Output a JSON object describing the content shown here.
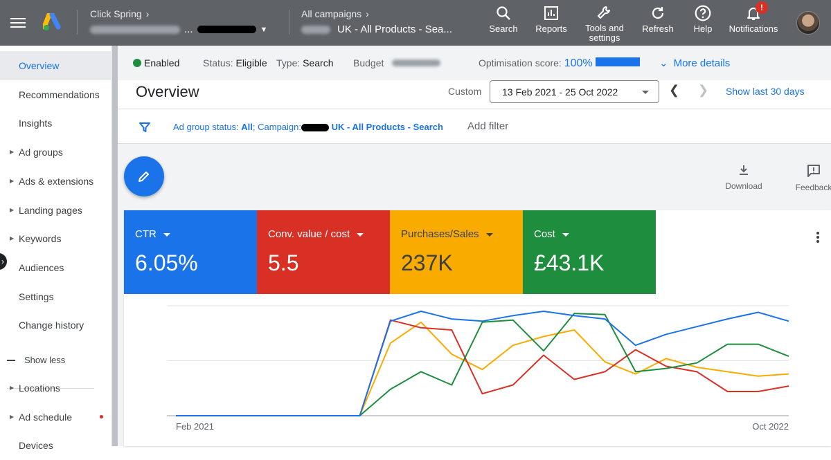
{
  "topbar": {
    "account_label": "Click Spring",
    "account_suffix": "...",
    "campaign_label": "All campaigns",
    "campaign_name": "UK - All Products - Sea...",
    "actions": [
      {
        "label": "Search",
        "icon": "search-icon"
      },
      {
        "label": "Reports",
        "icon": "reports-icon"
      },
      {
        "label": "Tools and\nsettings",
        "icon": "wrench-icon"
      },
      {
        "label": "Refresh",
        "icon": "refresh-icon"
      },
      {
        "label": "Help",
        "icon": "help-icon"
      },
      {
        "label": "Notifications",
        "icon": "bell-icon",
        "badge": "!"
      }
    ]
  },
  "sidebar": {
    "items": [
      {
        "label": "Overview",
        "active": true
      },
      {
        "label": "Recommendations"
      },
      {
        "label": "Insights"
      },
      {
        "label": "Ad groups",
        "expandable": true
      },
      {
        "label": "Ads & extensions",
        "expandable": true
      },
      {
        "label": "Landing pages",
        "expandable": true
      },
      {
        "label": "Keywords",
        "expandable": true
      },
      {
        "label": "Audiences"
      },
      {
        "label": "Settings"
      },
      {
        "label": "Change history"
      }
    ],
    "show_less": "Show less",
    "more_items": [
      {
        "label": "Locations",
        "expandable": true
      },
      {
        "label": "Ad schedule",
        "expandable": true,
        "alert": true
      },
      {
        "label": "Devices"
      }
    ]
  },
  "status": {
    "enabled": "Enabled",
    "status_label": "Status:",
    "status_value": "Eligible",
    "type_label": "Type:",
    "type_value": "Search",
    "budget_label": "Budget",
    "opt_label": "Optimisation score:",
    "opt_value": "100%",
    "opt_fraction": 1.0,
    "more_details": "More details"
  },
  "header": {
    "title": "Overview",
    "range_label": "Custom",
    "date_range": "13 Feb 2021 - 25 Oct 2022",
    "show_last": "Show last 30 days"
  },
  "filter": {
    "prefix": "Ad group status: ",
    "status": "All",
    "campaign_prefix": "; Campaign:",
    "campaign": " UK - All Products - Search",
    "add_filter": "Add filter"
  },
  "actions": {
    "download": "Download",
    "feedback": "Feedback"
  },
  "metrics": [
    {
      "label": "CTR",
      "value": "6.05%",
      "color": "#1a73e8"
    },
    {
      "label": "Conv. value / cost",
      "value": "5.5",
      "color": "#d93025"
    },
    {
      "label": "Purchases/Sales",
      "value": "237K",
      "color": "#f9ab00"
    },
    {
      "label": "Cost",
      "value": "£43.1K",
      "color": "#1e8e3e"
    }
  ],
  "chart_data": {
    "type": "line",
    "x_start": "Feb 2021",
    "x_end": "Oct 2022",
    "ylim": [
      0,
      100
    ],
    "grid": true,
    "series": [
      {
        "color": "#1a73e8",
        "values": [
          0,
          0,
          0,
          0,
          0,
          0,
          0,
          0,
          0,
          0,
          0,
          0,
          0,
          0,
          0,
          0,
          0,
          0,
          0,
          0,
          0,
          0,
          0,
          0,
          0,
          0,
          0,
          0,
          0,
          0,
          0,
          0,
          0,
          0,
          0,
          0,
          0,
          0,
          0,
          0,
          0,
          0,
          0,
          0,
          0,
          0,
          0,
          0,
          0,
          0,
          0,
          0,
          0,
          0,
          0,
          0,
          0,
          0,
          0,
          0,
          0,
          0,
          0,
          0,
          0,
          0,
          0,
          0,
          0,
          0,
          0,
          0,
          0,
          0,
          0,
          0,
          0,
          0,
          0,
          0
        ]
      }
    ],
    "lines": {
      "x": [
        0,
        6,
        7,
        8,
        9,
        10,
        11,
        12,
        13,
        14,
        15,
        16,
        17,
        18,
        19,
        20
      ],
      "ctr": [
        0,
        0,
        86,
        95,
        88,
        86,
        91,
        95,
        91,
        88,
        64,
        74,
        81,
        88,
        94,
        86
      ],
      "conv": [
        0,
        0,
        87,
        80,
        78,
        20,
        28,
        55,
        33,
        40,
        60,
        45,
        40,
        22,
        22,
        27
      ],
      "purch": [
        0,
        0,
        66,
        85,
        56,
        42,
        64,
        72,
        78,
        49,
        38,
        52,
        44,
        40,
        36,
        38
      ],
      "cost": [
        0,
        0,
        24,
        40,
        28,
        85,
        87,
        59,
        93,
        92,
        40,
        43,
        48,
        65,
        65,
        54
      ]
    }
  }
}
